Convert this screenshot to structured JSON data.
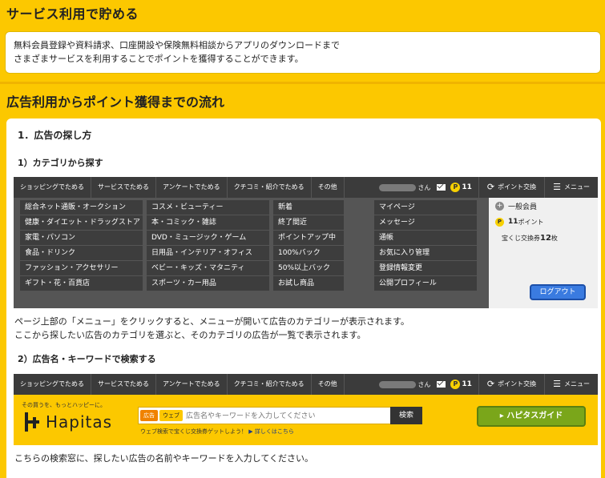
{
  "section1": {
    "title": "サービス利用で貯める",
    "lines": [
      "無料会員登録や資料請求、口座開設や保険無料相談からアプリのダウンロードまで",
      "さまざまサービスを利用することでポイントを獲得することができます。"
    ]
  },
  "section2": {
    "title": "広告利用からポイント獲得までの流れ",
    "step_title": "1．広告の探し方",
    "sub1": "1）カテゴリから探す",
    "sub2": "2）広告名・キーワードで検索する",
    "para1_lines": [
      "ページ上部の「メニュー」をクリックすると、メニューが開いて広告のカテゴリーが表示されます。",
      "ここから探したい広告のカテゴリを選ぶと、そのカテゴリの広告が一覧で表示されます。"
    ],
    "para2": "こちらの検索窓に、探したい広告の名前やキーワードを入力してください。"
  },
  "nav": {
    "tabs": [
      "ショッピングでためる",
      "サービスでためる",
      "アンケートでためる",
      "クチコミ・紹介でためる",
      "その他"
    ],
    "user_suffix": "さん",
    "points": "11",
    "point_exchange": "ポイント交換",
    "menu": "メニュー"
  },
  "menu_columns": {
    "col1": [
      "総合ネット通販・オークション",
      "健康・ダイエット・ドラッグストア",
      "家電・パソコン",
      "食品・ドリンク",
      "ファッション・アクセサリー",
      "ギフト・花・百貨店"
    ],
    "col2": [
      "コスメ・ビューティー",
      "本・コミック・雑誌",
      "DVD・ミュージック・ゲーム",
      "日用品・インテリア・オフィス",
      "ベビー・キッズ・マタニティ",
      "スポーツ・カー用品"
    ],
    "col3": [
      "新着",
      "終了間近",
      "ポイントアップ中",
      "100%バック",
      "50%以上バック",
      "お試し商品"
    ],
    "col4": [
      "マイページ",
      "メッセージ",
      "通帳",
      "お気に入り管理",
      "登録情報変更",
      "公開プロフィール"
    ]
  },
  "user_panel": {
    "member": "一般会員",
    "points_num": "11",
    "points_unit": "ポイント",
    "lottery_prefix": "宝くじ交換券",
    "lottery_num": "12",
    "lottery_unit": "枚",
    "logout": "ログアウト"
  },
  "search_banner": {
    "tagline": "その買うを、もっとハッピーに。",
    "logo": "Hapitas",
    "tag_ad": "広告",
    "tag_web": "ウェブ",
    "placeholder": "広告名やキーワードを入力してください",
    "search_button": "検索",
    "note": "ウェブ検索で宝くじ交換券ゲットしよう！",
    "note_link": "▶ 詳しくはこちら",
    "guide_button": "▸ ハピタスガイド"
  }
}
